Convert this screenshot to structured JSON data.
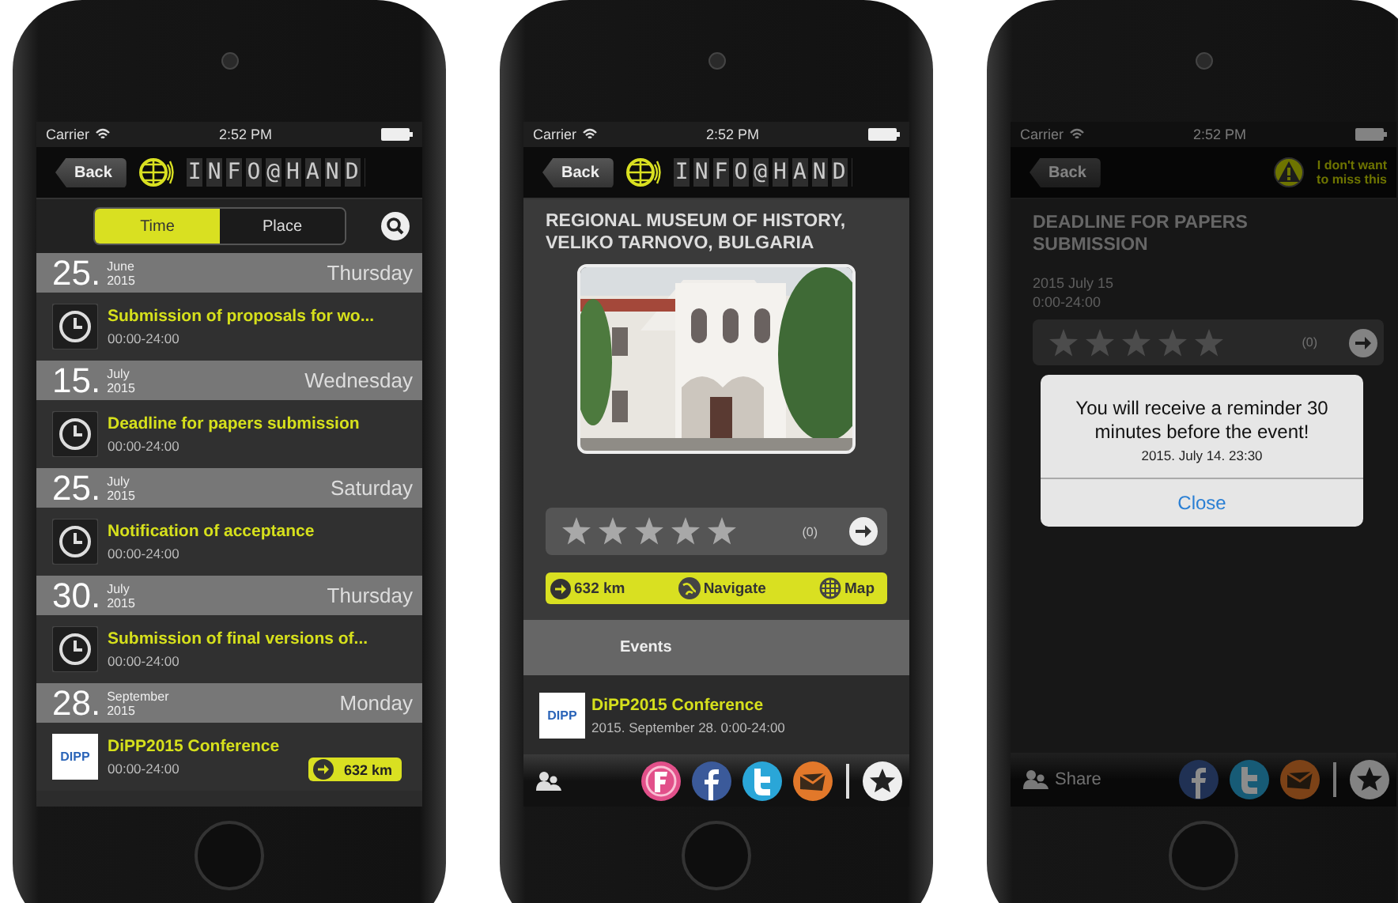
{
  "phones": [
    {
      "kind": "schedule",
      "status": {
        "carrier": "Carrier",
        "time": "2:52 PM"
      },
      "nav": {
        "back": "Back",
        "logo": "INFO@HAND"
      },
      "segments": [
        {
          "label": "Time",
          "selected": true
        },
        {
          "label": "Place",
          "selected": false
        }
      ],
      "days": [
        {
          "day": "25.",
          "month": "June",
          "year": "2015",
          "weekday": "Thursday",
          "events": [
            {
              "kind": "clock",
              "title": "Submission of proposals for wo...",
              "time": "00:00-24:00"
            }
          ]
        },
        {
          "day": "15.",
          "month": "July",
          "year": "2015",
          "weekday": "Wednesday",
          "events": [
            {
              "kind": "clock",
              "title": "Deadline for papers submission",
              "time": "00:00-24:00"
            }
          ]
        },
        {
          "day": "25.",
          "month": "July",
          "year": "2015",
          "weekday": "Saturday",
          "events": [
            {
              "kind": "clock",
              "title": "Notification of acceptance",
              "time": "00:00-24:00"
            }
          ]
        },
        {
          "day": "30.",
          "month": "July",
          "year": "2015",
          "weekday": "Thursday",
          "events": [
            {
              "kind": "clock",
              "title": "Submission of final versions of...",
              "time": "00:00-24:00"
            }
          ]
        },
        {
          "day": "28.",
          "month": "September",
          "year": "2015",
          "weekday": "Monday",
          "events": [
            {
              "kind": "logo",
              "logo": "DIPP",
              "title": "DiPP2015 Conference",
              "time": "00:00-24:00",
              "distance": "632 km"
            }
          ]
        }
      ]
    },
    {
      "kind": "place",
      "status": {
        "carrier": "Carrier",
        "time": "2:52 PM"
      },
      "nav": {
        "back": "Back",
        "logo": "INFO@HAND"
      },
      "title": "REGIONAL MUSEUM OF HISTORY, VELIKO TARNOVO, BULGARIA",
      "photo": {
        "kind": "picture"
      },
      "rating": {
        "stars": 0,
        "count": "(0)"
      },
      "actions": [
        {
          "kind": "distance",
          "label": "632 km"
        },
        {
          "kind": "navigate",
          "label": "Navigate"
        },
        {
          "kind": "map",
          "label": "Map"
        }
      ],
      "section": "Events",
      "events": [
        {
          "logo": "DIPP",
          "title": "DiPP2015 Conference",
          "when": "2015. September 28. 0:00-24:00"
        }
      ]
    },
    {
      "kind": "event",
      "status": {
        "carrier": "Carrier",
        "time": "2:52 PM"
      },
      "nav": {
        "back": "Back",
        "reminder": "I don't want to miss this"
      },
      "title": "DEADLINE FOR PAPERS SUBMISSION",
      "date": "2015 July 15",
      "time": "0:00-24:00",
      "rating": {
        "stars": 0,
        "count": "(0)"
      },
      "dialog": {
        "message": "You will receive a reminder 30 minutes before the event!",
        "when": "2015. July 14. 23:30",
        "button": "Close"
      },
      "share": "Share"
    }
  ]
}
